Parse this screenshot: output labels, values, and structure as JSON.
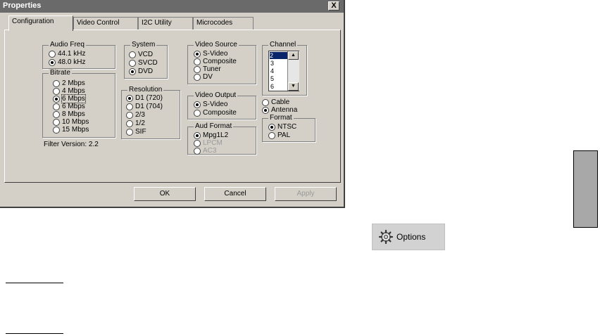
{
  "window": {
    "title": "Properties",
    "close": "X"
  },
  "tabs": [
    {
      "label": "Configuration",
      "active": true
    },
    {
      "label": "Video Control",
      "active": false
    },
    {
      "label": "I2C Utility",
      "active": false
    },
    {
      "label": "Microcodes",
      "active": false
    }
  ],
  "audio_freq": {
    "label": "Audio Freq",
    "options": [
      "44.1 kHz",
      "48.0 kHz"
    ],
    "selected": "48.0 kHz"
  },
  "bitrate": {
    "label": "Bitrate",
    "options": [
      "2 Mbps",
      "4 Mbps",
      "6 Mbps",
      "6 Mbps",
      "8 Mbps",
      "10 Mbps",
      "15 Mbps"
    ],
    "selected_index": 2
  },
  "system": {
    "label": "System",
    "options": [
      "VCD",
      "SVCD",
      "DVD"
    ],
    "selected": "DVD"
  },
  "resolution": {
    "label": "Resolution",
    "options": [
      "D1 (720)",
      "D1 (704)",
      "2/3",
      "1/2",
      "SIF"
    ],
    "selected": "D1 (720)"
  },
  "video_source": {
    "label": "Video Source",
    "options": [
      "S-Video",
      "Composite",
      "Tuner",
      "DV"
    ],
    "selected": "S-Video"
  },
  "video_output": {
    "label": "Video Output",
    "options": [
      "S-Video",
      "Composite"
    ],
    "selected": "S-Video"
  },
  "aud_format": {
    "label": "Aud Format",
    "options": [
      "Mpg1L2",
      "LPCM",
      "AC3"
    ],
    "selected": "Mpg1L2"
  },
  "channel": {
    "label": "Channel",
    "items": [
      "2",
      "3",
      "4",
      "5",
      "6"
    ],
    "selected": "2"
  },
  "tuner_input": {
    "options": [
      "Cable",
      "Antenna"
    ],
    "selected": "Antenna"
  },
  "format": {
    "label": "Format",
    "options": [
      "NTSC",
      "PAL"
    ],
    "selected": "NTSC"
  },
  "filter_version": "Filter Version: 2.2",
  "buttons": {
    "ok": "OK",
    "cancel": "Cancel",
    "apply": "Apply"
  },
  "options_button": {
    "label": "Options",
    "icon": "gear-icon"
  }
}
